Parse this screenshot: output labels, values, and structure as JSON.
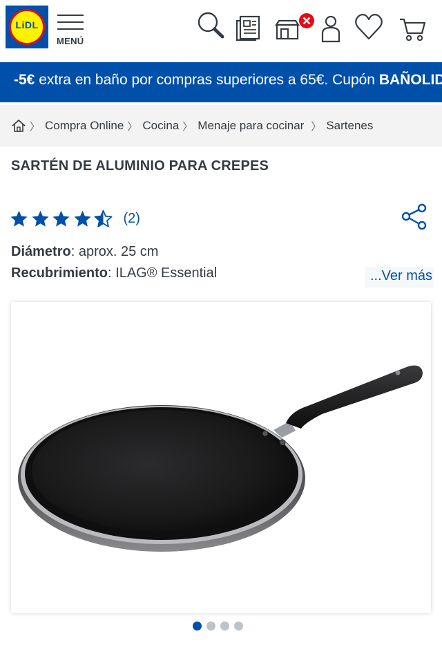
{
  "header": {
    "logo_text": "LiDL",
    "menu_label": "MENÚ",
    "icons": [
      "search-icon",
      "brochure-icon",
      "store-icon",
      "account-icon",
      "favorites-icon",
      "cart-icon"
    ],
    "brand_blue": "#0050aa",
    "brand_yellow": "#fff200",
    "brand_red": "#e60a14"
  },
  "promo": {
    "amount": "-5€",
    "text": " extra en baño por compras superiores a 65€. Cupón ",
    "code": "BAÑOLIDL"
  },
  "breadcrumb": {
    "items": [
      "Compra Online",
      "Cocina",
      "Menaje para cocinar",
      "Sartenes"
    ]
  },
  "product": {
    "title": "SARTÉN DE ALUMINIO PARA CREPES",
    "rating_value": 4.5,
    "rating_max": 5,
    "rating_count": "(2)",
    "specs": [
      {
        "label": "Diámetro",
        "value": ": aprox. 25 cm"
      },
      {
        "label": "Recubrimiento",
        "value": ": ILAG® Essential"
      }
    ],
    "ver_mas": "...Ver más",
    "image_subject": "crepe-pan"
  },
  "carousel": {
    "count": 4,
    "active": 1
  }
}
